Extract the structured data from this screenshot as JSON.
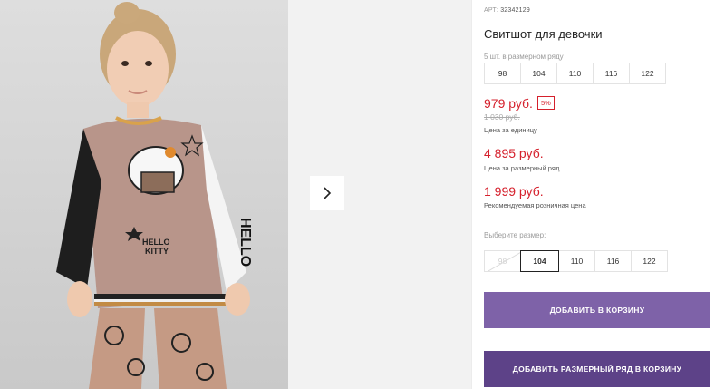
{
  "product": {
    "art_label": "АРТ:",
    "art_number": "32342129",
    "title": "Свитшот для девочки",
    "row_hint": "5 шт. в размерном ряду",
    "row_sizes": [
      "98",
      "104",
      "110",
      "116",
      "122"
    ],
    "price_unit": "979 руб.",
    "discount": "5%",
    "old_price": "1 030 руб.",
    "unit_label": "Цена за единицу",
    "price_row": "4 895 руб.",
    "row_label": "Цена за размерный ряд",
    "price_rrp": "1 999 руб.",
    "rrp_label": "Рекомендуемая розничная цена",
    "choose_label": "Выберите размер:",
    "size_options": [
      "98",
      "104",
      "110",
      "116",
      "122"
    ],
    "selected_size": "104",
    "add_button": "ДОБАВИТЬ В КОРЗИНУ",
    "add_row_button": "ДОБАВИТЬ РАЗМЕРНЫЙ РЯД В КОРЗИНУ"
  },
  "gallery": {
    "next_icon": "chevron-right-icon",
    "print_text": "HELLO KITTY",
    "sleeve_text": "HELLO"
  },
  "colors": {
    "price_red": "#d5202c",
    "button_primary": "#7e62a8",
    "button_dark": "#5d4288"
  }
}
